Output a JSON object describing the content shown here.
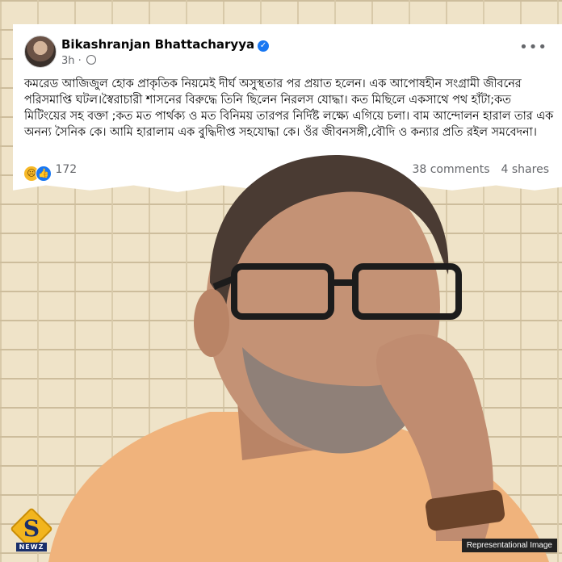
{
  "post": {
    "author": "Bikashranjan Bhattacharyya",
    "time": "3h",
    "text": "কমরেড আজিজুল হোক প্রাকৃতিক নিয়মেই দীর্ঘ অসুস্থতার পর প্রয়াত হলেন। এক আপোষহীন সংগ্রামী জীবনের পরিসমাপ্তি ঘটল।স্বৈরাচারী শাসনের বিরুদ্ধে তিনি ছিলেন নিরলস যোদ্ধা। কত মিছিলে একসাথে পথ হাঁটা;কত মিটিংয়ের সহ বক্তা ;কত মত পার্থক্য ও মত বিনিময় তারপর নির্দিষ্ট লক্ষ্যে এগিয়ে চলা। বাম আন্দোলন হারাল তার এক অনন্য সৈনিক কে। আমি হারালাম এক বুদ্ধিদীপ্ত সহযোদ্ধা কে। ওঁর জীবনসঙ্গী,বৌদি ও কন্যার প্রতি রইল সমবেদনা।",
    "reaction_count": "172",
    "comments": "38 comments",
    "shares": "4 shares"
  },
  "logo": {
    "letter": "S",
    "label": "NEWZ"
  },
  "caption": "Representational Image",
  "icons": [
    "verified-badge-icon",
    "globe-icon",
    "more-options-icon",
    "sad-reaction-icon",
    "like-reaction-icon"
  ]
}
